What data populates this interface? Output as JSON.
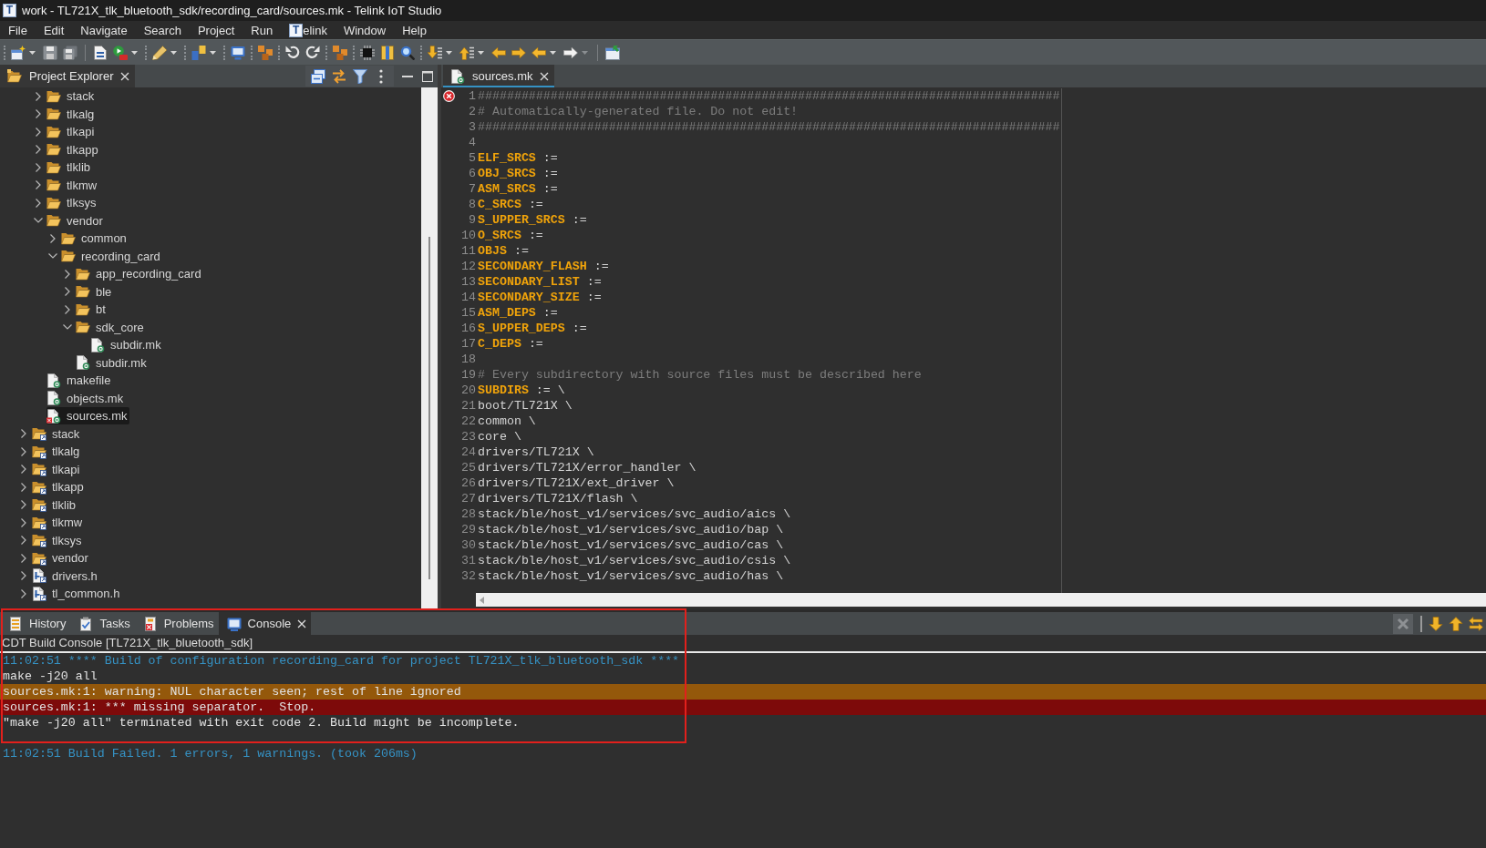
{
  "title_bar": {
    "logo_text": "T",
    "title": "work - TL721X_tlk_bluetooth_sdk/recording_card/sources.mk - Telink IoT Studio"
  },
  "menu_bar": [
    {
      "label": "File"
    },
    {
      "label": "Edit"
    },
    {
      "label": "Navigate"
    },
    {
      "label": "Search"
    },
    {
      "label": "Project"
    },
    {
      "label": "Run"
    },
    {
      "label": "elink",
      "logo_text": "T"
    },
    {
      "label": "Window"
    },
    {
      "label": "Help"
    }
  ],
  "project_explorer": {
    "tab": {
      "label": "Project Explorer",
      "selected": true
    },
    "tree": [
      {
        "children": [
          {
            "label": "stack",
            "kind": "folder",
            "expanded": false,
            "selected": false
          },
          {
            "label": "tlkalg",
            "kind": "folder",
            "expanded": false,
            "selected": false
          },
          {
            "label": "tlkapi",
            "kind": "folder",
            "expanded": false,
            "selected": false
          },
          {
            "label": "tlkapp",
            "kind": "folder",
            "expanded": false,
            "selected": false
          },
          {
            "label": "tlklib",
            "kind": "folder",
            "expanded": false,
            "selected": false
          },
          {
            "label": "tlkmw",
            "kind": "folder",
            "expanded": false,
            "selected": false
          },
          {
            "label": "tlksys",
            "kind": "folder",
            "expanded": false,
            "selected": false
          },
          {
            "label": "vendor",
            "kind": "folder",
            "expanded": true,
            "selected": false,
            "children": [
              {
                "label": "common",
                "kind": "folder",
                "expanded": false,
                "selected": false
              },
              {
                "label": "recording_card",
                "kind": "folder",
                "expanded": true,
                "selected": false,
                "children": [
                  {
                    "label": "app_recording_card",
                    "kind": "folder",
                    "expanded": false,
                    "selected": false
                  },
                  {
                    "label": "ble",
                    "kind": "folder",
                    "expanded": false,
                    "selected": false
                  },
                  {
                    "label": "bt",
                    "kind": "folder",
                    "expanded": false,
                    "selected": false
                  },
                  {
                    "label": "sdk_core",
                    "kind": "folder",
                    "expanded": true,
                    "selected": false,
                    "children": [
                      {
                        "label": "subdir.mk",
                        "kind": "make-file",
                        "error": false,
                        "selected": false
                      }
                    ]
                  },
                  {
                    "label": "subdir.mk",
                    "kind": "make-file",
                    "error": false,
                    "selected": false
                  }
                ]
              }
            ]
          },
          {
            "label": "makefile",
            "kind": "make-file",
            "error": false,
            "selected": false
          },
          {
            "label": "objects.mk",
            "kind": "make-file",
            "error": false,
            "selected": false
          },
          {
            "label": "sources.mk",
            "kind": "make-file",
            "error": true,
            "selected": true
          }
        ]
      },
      {
        "label": "stack",
        "kind": "linked-folder",
        "expanded": false,
        "selected": false
      },
      {
        "label": "tlkalg",
        "kind": "linked-folder",
        "expanded": false,
        "selected": false
      },
      {
        "label": "tlkapi",
        "kind": "linked-folder",
        "expanded": false,
        "selected": false
      },
      {
        "label": "tlkapp",
        "kind": "linked-folder",
        "expanded": false,
        "selected": false
      },
      {
        "label": "tlklib",
        "kind": "linked-folder",
        "expanded": false,
        "selected": false
      },
      {
        "label": "tlkmw",
        "kind": "linked-folder",
        "expanded": false,
        "selected": false
      },
      {
        "label": "tlksys",
        "kind": "linked-folder",
        "expanded": false,
        "selected": false
      },
      {
        "label": "vendor",
        "kind": "linked-folder",
        "expanded": false,
        "selected": false
      },
      {
        "label": "drivers.h",
        "kind": "header-file",
        "expanded": false,
        "error": false,
        "selected": false
      },
      {
        "label": "tl_common.h",
        "kind": "header-file",
        "expanded": false,
        "error": false,
        "selected": false
      }
    ]
  },
  "editor": {
    "tab": {
      "label": "sources.mk",
      "selected": true
    },
    "lines": [
      {
        "number": "1",
        "kind": "comment",
        "text": "################################################################################",
        "error": true
      },
      {
        "number": "2",
        "kind": "comment",
        "text": "# Automatically-generated file. Do not edit!",
        "error": false
      },
      {
        "number": "3",
        "kind": "comment",
        "text": "################################################################################",
        "error": false
      },
      {
        "number": "4",
        "kind": "blank",
        "error": false
      },
      {
        "number": "5",
        "kind": "variable",
        "name": "ELF_SRCS",
        "rest": ":=",
        "error": false
      },
      {
        "number": "6",
        "kind": "variable",
        "name": "OBJ_SRCS",
        "rest": ":=",
        "error": false
      },
      {
        "number": "7",
        "kind": "variable",
        "name": "ASM_SRCS",
        "rest": ":=",
        "error": false
      },
      {
        "number": "8",
        "kind": "variable",
        "name": "C_SRCS",
        "rest": ":=",
        "error": false
      },
      {
        "number": "9",
        "kind": "variable",
        "name": "S_UPPER_SRCS",
        "rest": ":=",
        "error": false
      },
      {
        "number": "10",
        "kind": "variable",
        "name": "O_SRCS",
        "rest": ":=",
        "error": false
      },
      {
        "number": "11",
        "kind": "variable",
        "name": "OBJS",
        "rest": ":=",
        "error": false
      },
      {
        "number": "12",
        "kind": "variable",
        "name": "SECONDARY_FLASH",
        "rest": ":=",
        "error": false
      },
      {
        "number": "13",
        "kind": "variable",
        "name": "SECONDARY_LIST",
        "rest": ":=",
        "error": false
      },
      {
        "number": "14",
        "kind": "variable",
        "name": "SECONDARY_SIZE",
        "rest": ":=",
        "error": false
      },
      {
        "number": "15",
        "kind": "variable",
        "name": "ASM_DEPS",
        "rest": ":=",
        "error": false
      },
      {
        "number": "16",
        "kind": "variable",
        "name": "S_UPPER_DEPS",
        "rest": ":=",
        "error": false
      },
      {
        "number": "17",
        "kind": "variable",
        "name": "C_DEPS",
        "rest": ":=",
        "error": false
      },
      {
        "number": "18",
        "kind": "blank",
        "error": false
      },
      {
        "number": "19",
        "kind": "comment",
        "text": "# Every subdirectory with source files must be described here",
        "error": false
      },
      {
        "number": "20",
        "kind": "variable",
        "name": "SUBDIRS",
        "rest": ":= \\",
        "error": false
      },
      {
        "number": "21",
        "kind": "plain",
        "text": "boot/TL721X \\",
        "error": false
      },
      {
        "number": "22",
        "kind": "plain",
        "text": "common \\",
        "error": false
      },
      {
        "number": "23",
        "kind": "plain",
        "text": "core \\",
        "error": false
      },
      {
        "number": "24",
        "kind": "plain",
        "text": "drivers/TL721X \\",
        "error": false
      },
      {
        "number": "25",
        "kind": "plain",
        "text": "drivers/TL721X/error_handler \\",
        "error": false
      },
      {
        "number": "26",
        "kind": "plain",
        "text": "drivers/TL721X/ext_driver \\",
        "error": false
      },
      {
        "number": "27",
        "kind": "plain",
        "text": "drivers/TL721X/flash \\",
        "error": false
      },
      {
        "number": "28",
        "kind": "plain",
        "text": "stack/ble/host_v1/services/svc_audio/aics \\",
        "error": false
      },
      {
        "number": "29",
        "kind": "plain",
        "text": "stack/ble/host_v1/services/svc_audio/bap \\",
        "error": false
      },
      {
        "number": "30",
        "kind": "plain",
        "text": "stack/ble/host_v1/services/svc_audio/cas \\",
        "error": false
      },
      {
        "number": "31",
        "kind": "plain",
        "text": "stack/ble/host_v1/services/svc_audio/csis \\",
        "error": false
      },
      {
        "number": "32",
        "kind": "plain",
        "text": "stack/ble/host_v1/services/svc_audio/has \\",
        "error": false
      }
    ]
  },
  "bottom_panel": {
    "tabs": [
      {
        "label": "History",
        "kind": "history",
        "selected": false
      },
      {
        "label": "Tasks",
        "kind": "tasks",
        "selected": false
      },
      {
        "label": "Problems",
        "kind": "problems",
        "selected": false
      },
      {
        "label": "Console",
        "kind": "console",
        "selected": true
      }
    ],
    "console": {
      "title": "CDT Build Console [TL721X_tlk_bluetooth_sdk]",
      "lines": [
        {
          "kind": "info",
          "text": "11:02:51 **** Build of configuration recording_card for project TL721X_tlk_bluetooth_sdk ****"
        },
        {
          "kind": "plain",
          "text": "make -j20 all"
        },
        {
          "kind": "warning",
          "text": "sources.mk:1: warning: NUL character seen; rest of line ignored"
        },
        {
          "kind": "error",
          "text": "sources.mk:1: *** missing separator.  Stop."
        },
        {
          "kind": "plain",
          "text": "\"make -j20 all\" terminated with exit code 2. Build might be incomplete."
        }
      ],
      "summary": "11:02:51 Build Failed. 1 errors, 1 warnings. (took 206ms)"
    }
  }
}
